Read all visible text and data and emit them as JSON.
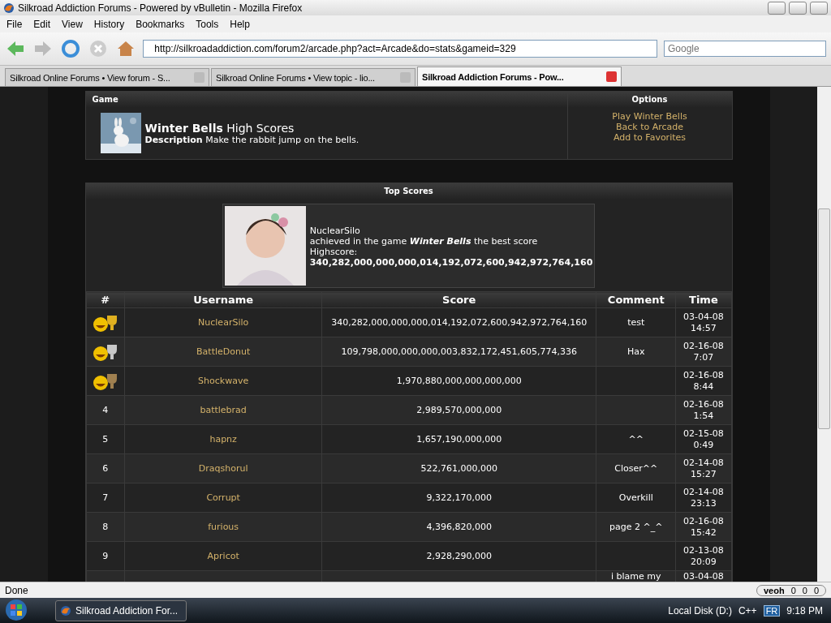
{
  "window": {
    "title": "Silkroad Addiction Forums - Powered by vBulletin - Mozilla Firefox"
  },
  "menu": [
    "File",
    "Edit",
    "View",
    "History",
    "Bookmarks",
    "Tools",
    "Help"
  ],
  "address_bar": {
    "value": "http://silkroadaddiction.com/forum2/arcade.php?act=Arcade&do=stats&gameid=329"
  },
  "search": {
    "placeholder": "Google"
  },
  "tabs": [
    {
      "label": "Silkroad Online Forums • View forum - S...",
      "selected": false
    },
    {
      "label": "Silkroad Online Forums • View topic - lio...",
      "selected": false
    },
    {
      "label": "Silkroad Addiction Forums - Pow...",
      "selected": true
    }
  ],
  "game_panel": {
    "header_game": "Game",
    "header_options": "Options",
    "title": "Winter Bells",
    "title_suffix": "High Scores",
    "description_label": "Description",
    "description": "Make the rabbit jump on the bells.",
    "options": [
      "Play Winter Bells",
      "Back to Arcade",
      "Add to Favorites"
    ]
  },
  "top_scores": {
    "title": "Top Scores",
    "username": "NuclearSilo",
    "line_before": "achieved in the game",
    "game": "Winter Bells",
    "line_after": "the best score",
    "highscore_label": "Highscore:",
    "highscore": "340,282,000,000,000,014,192,072,600,942,972,764,160"
  },
  "table": {
    "columns": [
      "#",
      "Username",
      "Score",
      "Comment",
      "Time"
    ],
    "rows": [
      {
        "kind": "trophy",
        "color": "#e0b020",
        "username": "NuclearSilo",
        "score": "340,282,000,000,000,014,192,072,600,942,972,764,160",
        "comment": "test",
        "date": "03-04-08",
        "clock": "14:57"
      },
      {
        "kind": "trophy",
        "color": "#c8c8c8",
        "username": "BattleDonut",
        "score": "109,798,000,000,000,003,832,172,451,605,774,336",
        "comment": "Hax",
        "date": "02-16-08",
        "clock": "7:07"
      },
      {
        "kind": "trophy",
        "color": "#a08050",
        "username": "Shockwave",
        "score": "1,970,880,000,000,000,000",
        "date": "02-16-08",
        "clock": "8:44"
      },
      {
        "kind": "number",
        "rank": "4",
        "username": "battlebrad",
        "score": "2,989,570,000,000",
        "date": "02-16-08",
        "clock": "1:54"
      },
      {
        "kind": "number",
        "rank": "5",
        "username": "hapnz",
        "score": "1,657,190,000,000",
        "comment": "^^",
        "date": "02-15-08",
        "clock": "0:49"
      },
      {
        "kind": "number",
        "rank": "6",
        "username": "Draqshorul",
        "score": "522,761,000,000",
        "comment": "Closer^^",
        "date": "02-14-08",
        "clock": "15:27"
      },
      {
        "kind": "number",
        "rank": "7",
        "username": "Corrupt",
        "score": "9,322,170,000",
        "comment": "Overkill",
        "date": "02-14-08",
        "clock": "23:13"
      },
      {
        "kind": "number",
        "rank": "8",
        "username": "furious",
        "score": "4,396,820,000",
        "comment": "page 2 ^_^",
        "date": "02-16-08",
        "clock": "15:42"
      },
      {
        "kind": "number",
        "rank": "9",
        "username": "Apricot",
        "score": "2,928,290,000",
        "date": "02-13-08",
        "clock": "20:09"
      },
      {
        "kind": "partial",
        "comment": "i blame my",
        "date": "03-04-08"
      }
    ]
  },
  "status_bar": {
    "text": "Done",
    "veoh": "veoh",
    "counts": [
      "0",
      "0",
      "0"
    ]
  },
  "taskbar": {
    "task": "Silkroad Addiction For...",
    "folders": [
      "Local Disk (D:)",
      "C++"
    ],
    "language": "FR",
    "clock": "9:18 PM"
  }
}
